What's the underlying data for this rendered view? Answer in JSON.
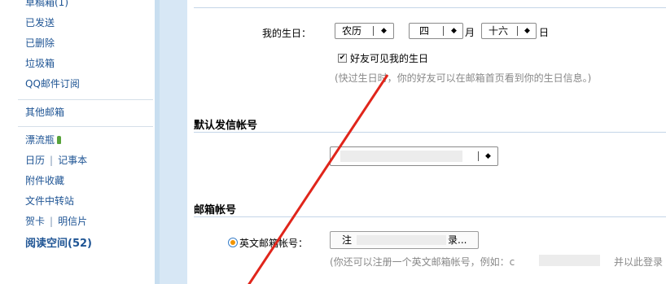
{
  "sidebar": {
    "items": [
      {
        "label": "草稿箱(1)"
      },
      {
        "label": "已发送"
      },
      {
        "label": "已删除"
      },
      {
        "label": "垃圾箱"
      },
      {
        "label": "QQ邮件订阅"
      },
      {
        "label": "其他邮箱"
      },
      {
        "label": "漂流瓶"
      },
      {
        "label_a": "日历",
        "label_b": "记事本"
      },
      {
        "label": "附件收藏"
      },
      {
        "label": "文件中转站"
      },
      {
        "label_a": "贺卡",
        "label_b": "明信片"
      },
      {
        "label": "阅读空间(52)"
      }
    ]
  },
  "birthday": {
    "label": "我的生日：",
    "calendar_type": "农历",
    "month": "四",
    "month_unit": "月",
    "day": "十六",
    "day_unit": "日",
    "checkbox_label": "好友可见我的生日",
    "checkbox_mark": "✔",
    "hint": "(快过生日时，你的好友可以在邮箱首页看到你的生日信息。)"
  },
  "default_sender": {
    "title": "默认发信帐号"
  },
  "mail_account": {
    "title": "邮箱帐号",
    "english_label": "英文邮箱帐号：",
    "button_prefix": "注",
    "button_suffix": "录...",
    "hint_prefix": "(你还可以注册一个英文邮箱帐号，例如：c",
    "hint_suffix": "并以此登录"
  },
  "arrow": "◆",
  "colors": {
    "link": "#1e5494",
    "sidebar_edge": "#c8def0",
    "annotation": "#e0251b"
  }
}
